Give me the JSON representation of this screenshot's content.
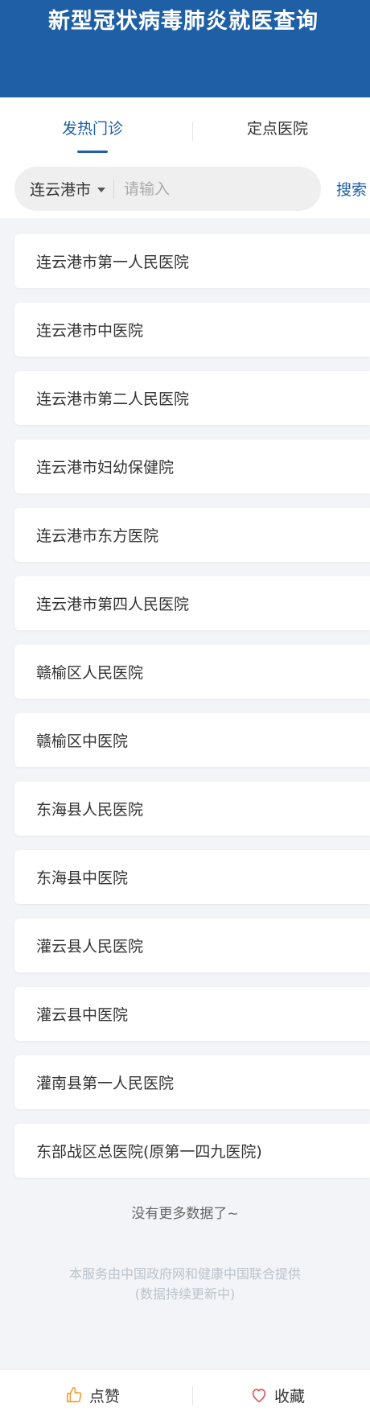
{
  "header": {
    "title": "新型冠状病毒肺炎就医查询"
  },
  "tabs": [
    {
      "label": "发热门诊",
      "active": true
    },
    {
      "label": "定点医院",
      "active": false
    }
  ],
  "search": {
    "city": "连云港市",
    "placeholder": "请输入",
    "button_label": "搜索"
  },
  "hospitals": [
    "连云港市第一人民医院",
    "连云港市中医院",
    "连云港市第二人民医院",
    "连云港市妇幼保健院",
    "连云港市东方医院",
    "连云港市第四人民医院",
    "赣榆区人民医院",
    "赣榆区中医院",
    "东海县人民医院",
    "东海县中医院",
    "灌云县人民医院",
    "灌云县中医院",
    "灌南县第一人民医院",
    "东部战区总医院(原第一四九医院)"
  ],
  "no_more_text": "没有更多数据了~",
  "footer_note": {
    "line1": "本服务由中国政府网和健康中国联合提供",
    "line2": "(数据持续更新中)"
  },
  "bottom_bar": {
    "like_label": "点赞",
    "like_icon": "thumbs-up-icon",
    "favorite_label": "收藏",
    "favorite_icon": "heart-icon"
  },
  "colors": {
    "brand_blue": "#1e5fa6",
    "like_orange": "#f0a030",
    "favorite_red": "#e0575b",
    "page_background": "#f2f4f7"
  }
}
